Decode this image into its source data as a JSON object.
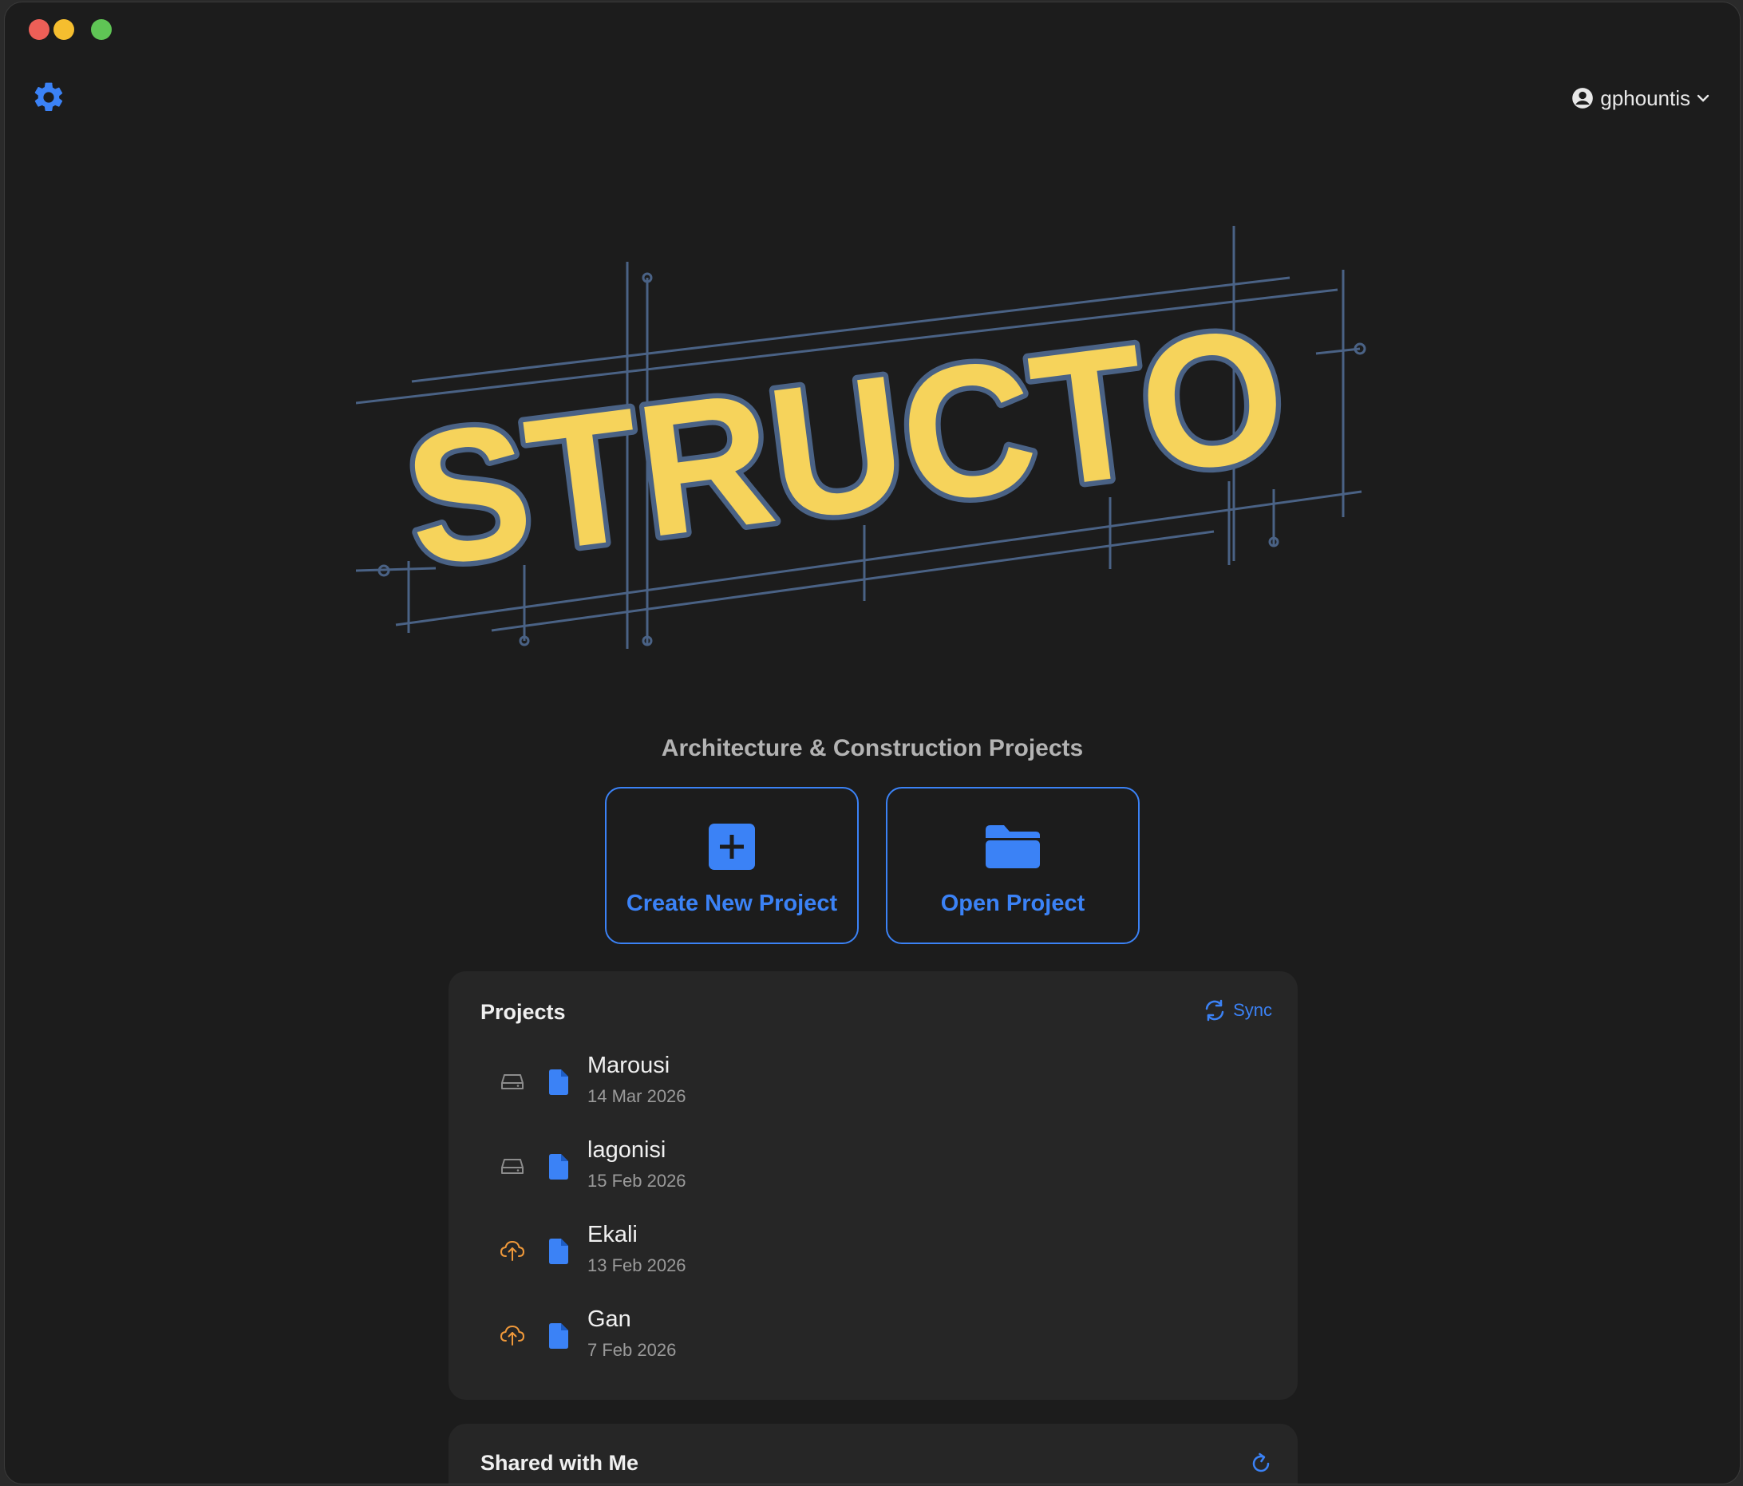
{
  "app": {
    "brand": "STRUCTO",
    "tagline": "Architecture & Construction Projects"
  },
  "toolbar": {
    "settings_icon": "gear-icon",
    "user": {
      "icon": "person-circle-icon",
      "username": "gphountis",
      "chevron_icon": "chevron-down-icon"
    }
  },
  "actions": {
    "create": {
      "label": "Create New Project",
      "icon": "plus-square-icon"
    },
    "open": {
      "label": "Open Project",
      "icon": "folder-icon"
    }
  },
  "projects": {
    "title": "Projects",
    "sync_label": "Sync",
    "items": [
      {
        "name": "Marousi",
        "date": "14 Mar 2026",
        "status": "local"
      },
      {
        "name": "lagonisi",
        "date": "15 Feb 2026",
        "status": "local"
      },
      {
        "name": "Ekali",
        "date": "13 Feb 2026",
        "status": "cloud-upload"
      },
      {
        "name": "Gan",
        "date": "7 Feb 2026",
        "status": "cloud-upload"
      }
    ]
  },
  "shared": {
    "title": "Shared with Me",
    "refresh_icon": "refresh-icon"
  },
  "colors": {
    "accent": "#3b82f6",
    "logo_fill": "#f6d35b",
    "logo_outline": "#4a6285",
    "upload_status": "#f0993a",
    "window_bg": "#1c1c1c",
    "panel_bg": "#262626"
  }
}
